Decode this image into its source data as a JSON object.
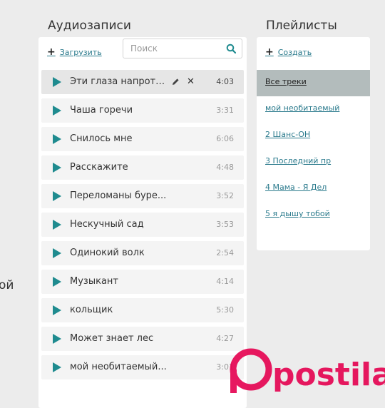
{
  "edge_text": "ой",
  "audio": {
    "title": "Аудиозаписи",
    "upload_label": "Загрузить",
    "search_placeholder": "Поиск",
    "tracks": [
      {
        "title": "Эти глаза напрот…",
        "duration": "4:03",
        "active": true
      },
      {
        "title": "Чаша горечи",
        "duration": "3:31"
      },
      {
        "title": "Снилось мне",
        "duration": "6:06"
      },
      {
        "title": "Расскажите",
        "duration": "4:48"
      },
      {
        "title": "Переломаны буре...",
        "duration": "3:52"
      },
      {
        "title": "Нескучный сад",
        "duration": "3:53"
      },
      {
        "title": "Одинокий волк",
        "duration": "2:54"
      },
      {
        "title": "Музыкант",
        "duration": "4:14"
      },
      {
        "title": "кольщик",
        "duration": "5:30"
      },
      {
        "title": "Может знает лес",
        "duration": "4:27"
      },
      {
        "title": "мой необитаемый...",
        "duration": "3:01"
      }
    ]
  },
  "playlists": {
    "title": "Плейлисты",
    "create_label": "Создать",
    "items": [
      {
        "label": "Все треки",
        "active": true
      },
      {
        "label": "мой необитаемый"
      },
      {
        "label": "2 Шанс-ОН"
      },
      {
        "label": "3 Последний пр"
      },
      {
        "label": "4 Мама - Я Дел"
      },
      {
        "label": "5 я дышу тобой"
      }
    ]
  },
  "watermark": "postila.ru",
  "colors": {
    "accent": "#1f8b8f",
    "link": "#2a7a8c",
    "background": "#ececec",
    "active_playlist": "#b3bcbc",
    "watermark": "#e5004f"
  }
}
